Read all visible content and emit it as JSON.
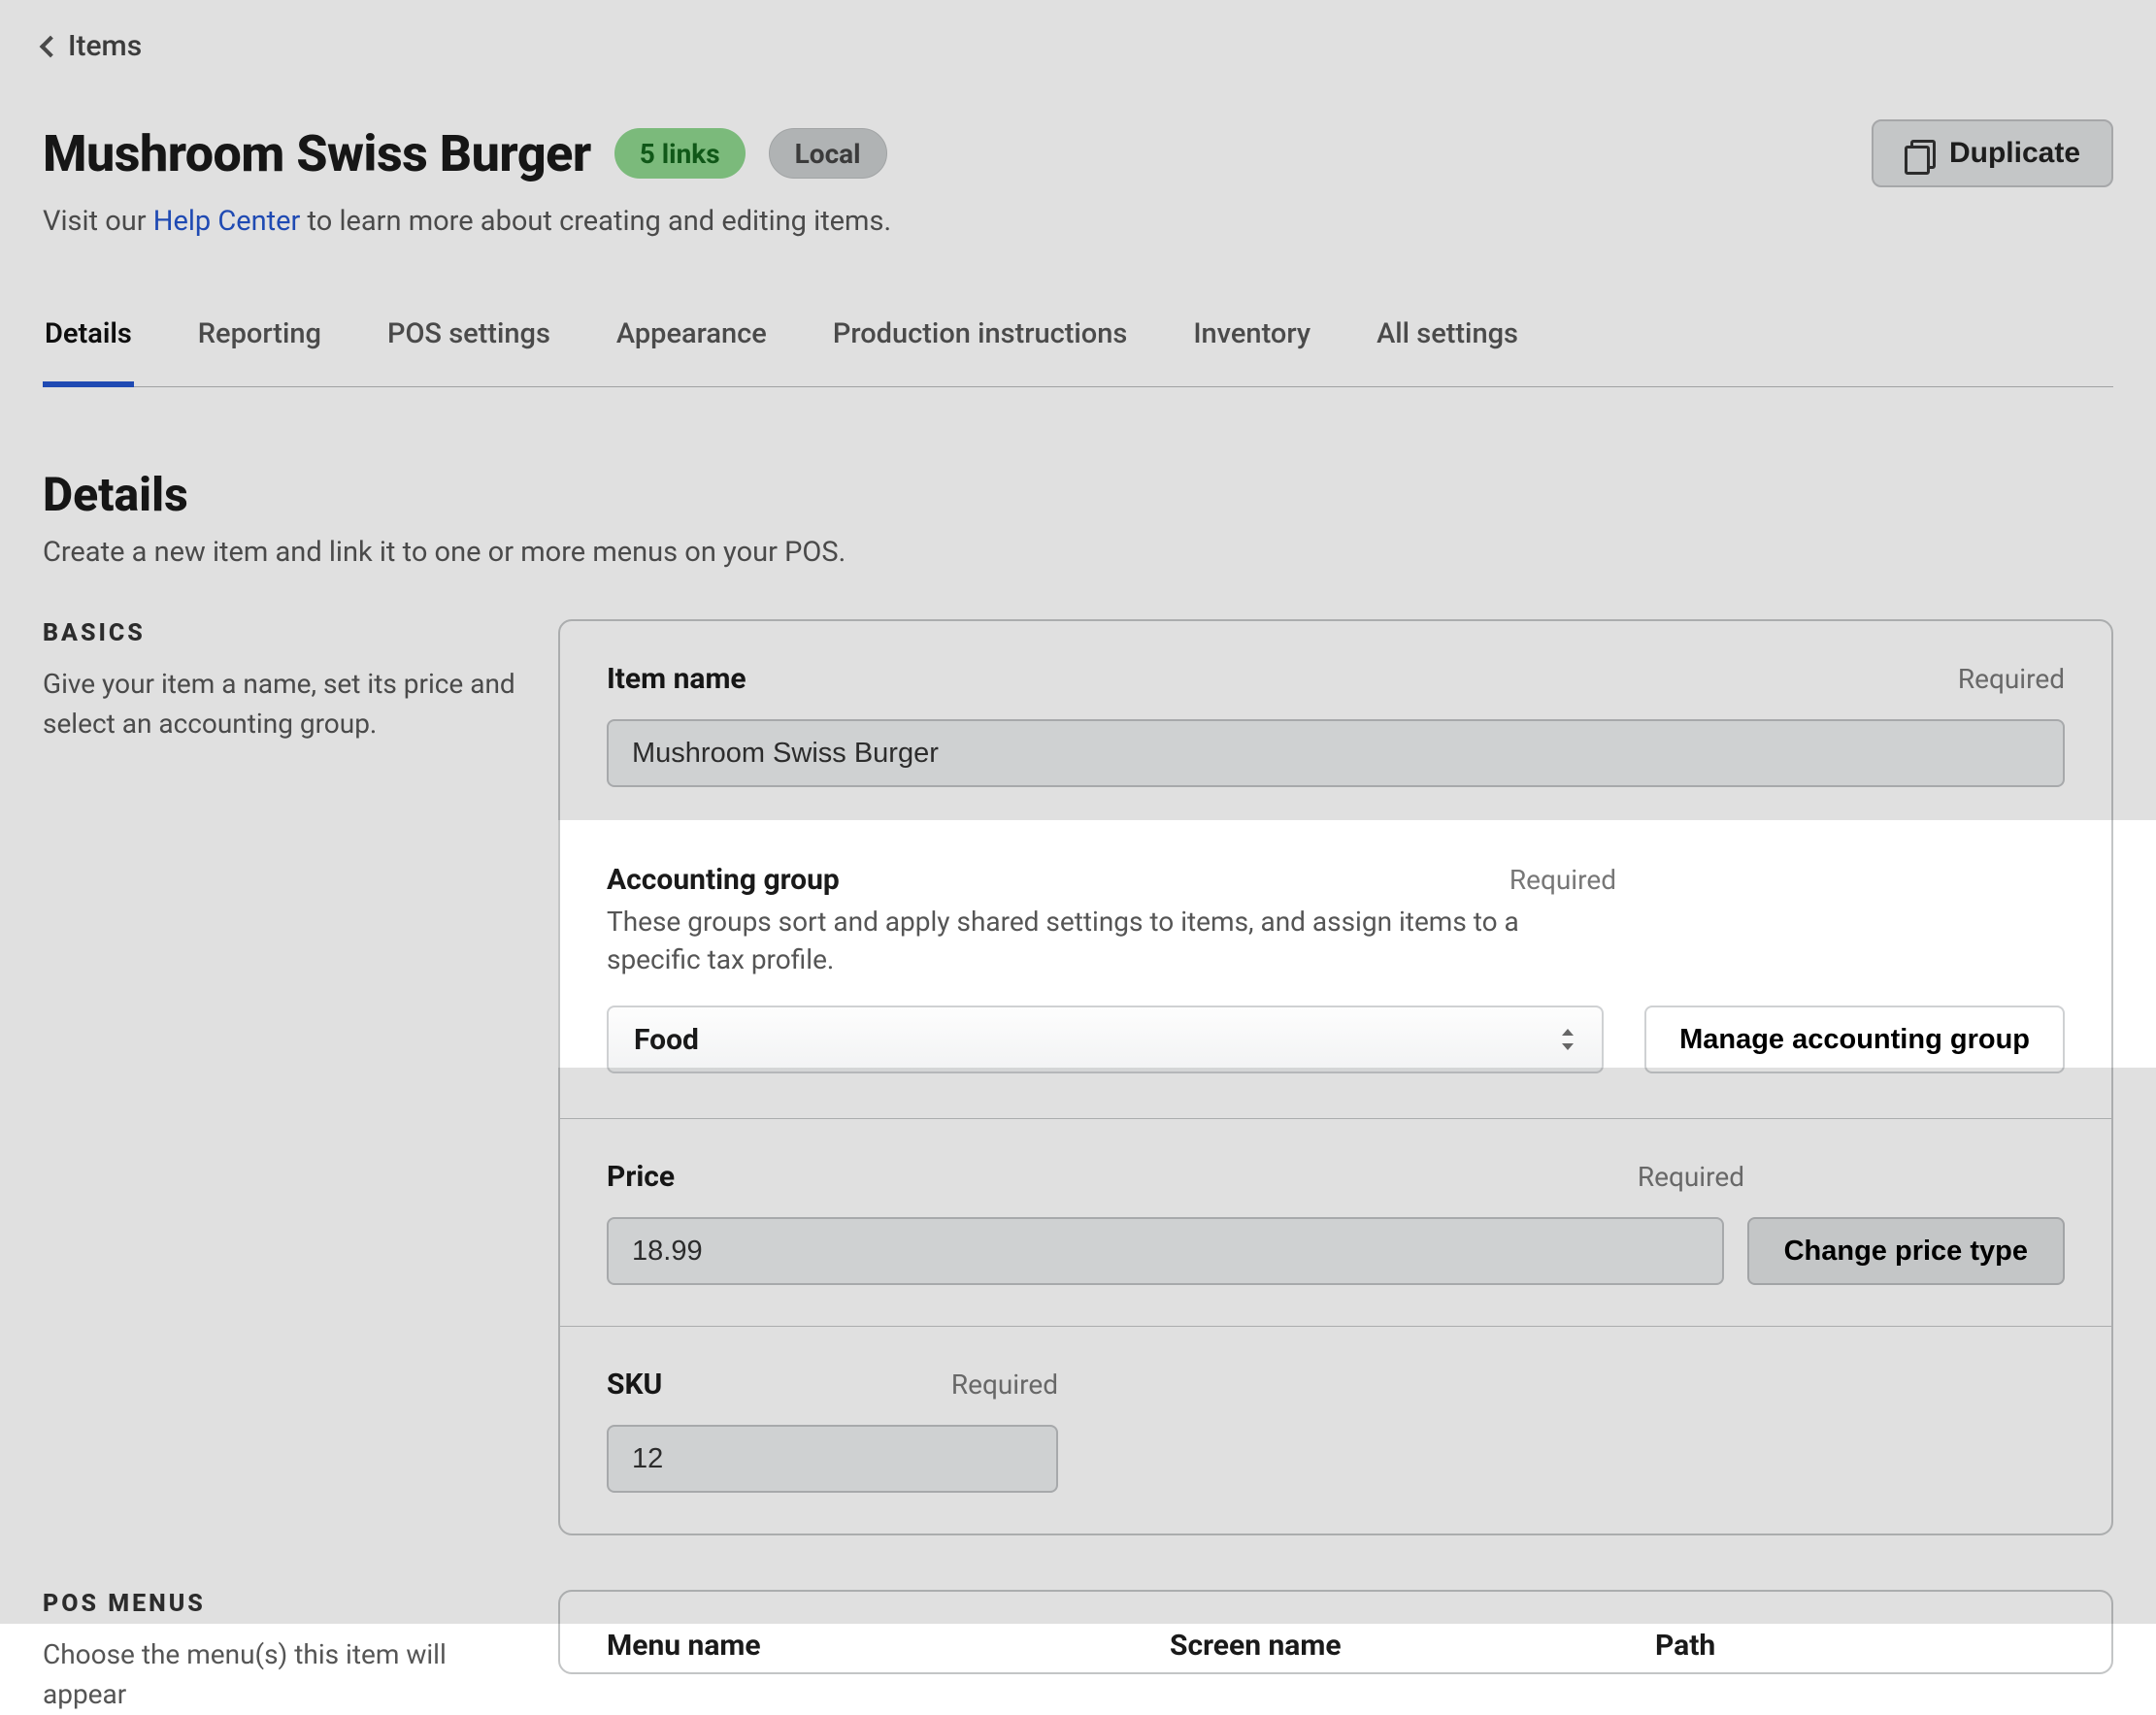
{
  "breadcrumb": {
    "label": "Items"
  },
  "header": {
    "title": "Mushroom Swiss Burger",
    "links_badge": "5 links",
    "scope_badge": "Local",
    "duplicate_label": "Duplicate"
  },
  "subtitle": {
    "prefix": "Visit our ",
    "link": "Help Center",
    "suffix": " to learn more about creating and editing items."
  },
  "tabs": [
    {
      "id": "details",
      "label": "Details",
      "active": true
    },
    {
      "id": "reporting",
      "label": "Reporting"
    },
    {
      "id": "pos-settings",
      "label": "POS settings"
    },
    {
      "id": "appearance",
      "label": "Appearance"
    },
    {
      "id": "production",
      "label": "Production instructions"
    },
    {
      "id": "inventory",
      "label": "Inventory"
    },
    {
      "id": "all",
      "label": "All settings"
    }
  ],
  "details": {
    "heading": "Details",
    "subheading": "Create a new item and link it to one or more menus on your POS."
  },
  "basics": {
    "side_title": "BASICS",
    "side_text": "Give your item a name, set its price and select an accounting group.",
    "item_name": {
      "label": "Item name",
      "required": "Required",
      "value": "Mushroom Swiss Burger"
    },
    "accounting_group": {
      "label": "Accounting group",
      "required": "Required",
      "help": "These groups sort and apply shared settings to items, and assign items to a specific tax profile.",
      "value": "Food",
      "manage_label": "Manage accounting group"
    },
    "price": {
      "label": "Price",
      "required": "Required",
      "value": "18.99",
      "change_label": "Change price type"
    },
    "sku": {
      "label": "SKU",
      "required": "Required",
      "value": "12"
    }
  },
  "pos_menus": {
    "side_title": "POS MENUS",
    "side_text": "Choose the menu(s) this item will appear",
    "columns": {
      "menu": "Menu name",
      "screen": "Screen name",
      "path": "Path"
    }
  }
}
